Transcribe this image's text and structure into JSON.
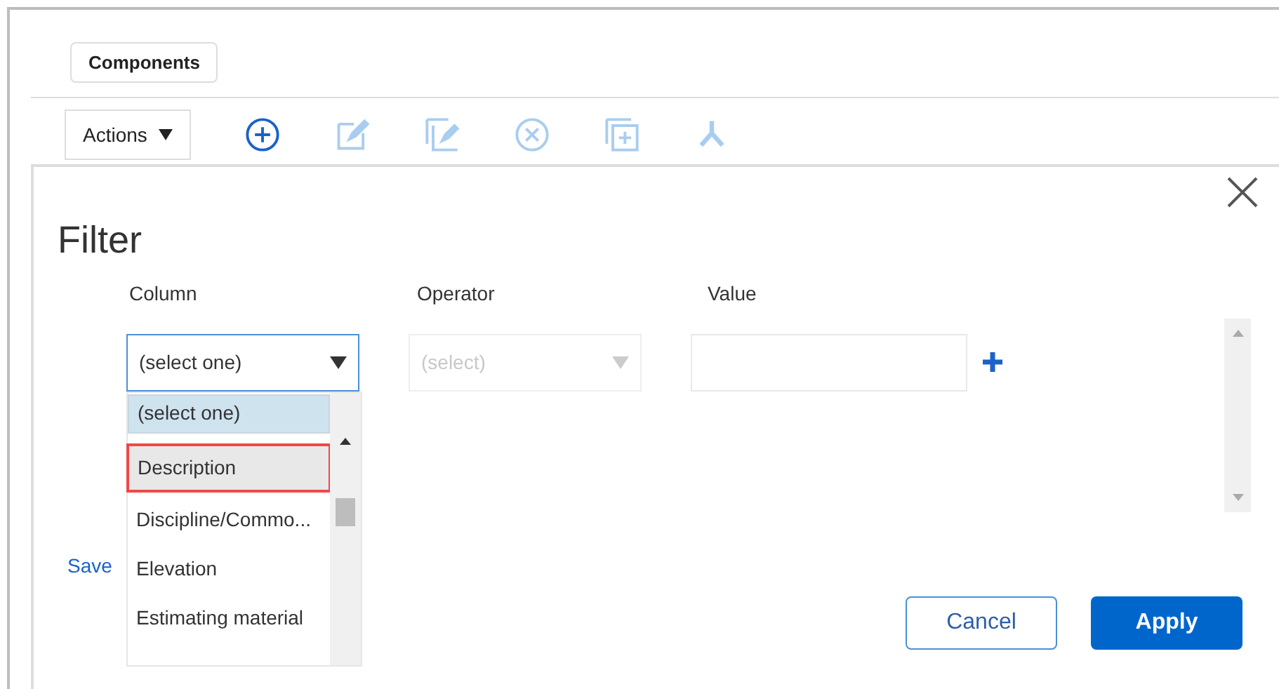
{
  "tabs": [
    {
      "label": "Components",
      "selected": true
    }
  ],
  "toolbar": {
    "actions_menu": "Actions",
    "icons": [
      {
        "kind": "add",
        "disabled": false
      },
      {
        "kind": "edit",
        "disabled": true
      },
      {
        "kind": "edit-multiple",
        "disabled": true
      },
      {
        "kind": "delete",
        "disabled": true
      },
      {
        "kind": "copy",
        "disabled": true
      },
      {
        "kind": "split",
        "disabled": true
      }
    ]
  },
  "dialog": {
    "title": "Filter",
    "headers": [
      "Column",
      "Operator",
      "Value"
    ],
    "column_select": {
      "value": "(select one)",
      "expanded": true
    },
    "operator_select": {
      "placeholder": "(select)",
      "disabled": true
    },
    "dropdown": {
      "items": [
        {
          "label": "(select one)",
          "selected": true,
          "hovered": false
        },
        {
          "label": "Description",
          "selected": false,
          "hovered": true
        },
        {
          "label": "Discipline/Commo...",
          "selected": false,
          "hovered": false
        },
        {
          "label": "Elevation",
          "selected": false,
          "hovered": false
        },
        {
          "label": "Estimating material",
          "selected": false,
          "hovered": false
        }
      ]
    },
    "save_link": "Save",
    "buttons": [
      {
        "label": "Cancel",
        "kind": "secondary"
      },
      {
        "label": "Apply",
        "kind": "primary"
      }
    ]
  }
}
